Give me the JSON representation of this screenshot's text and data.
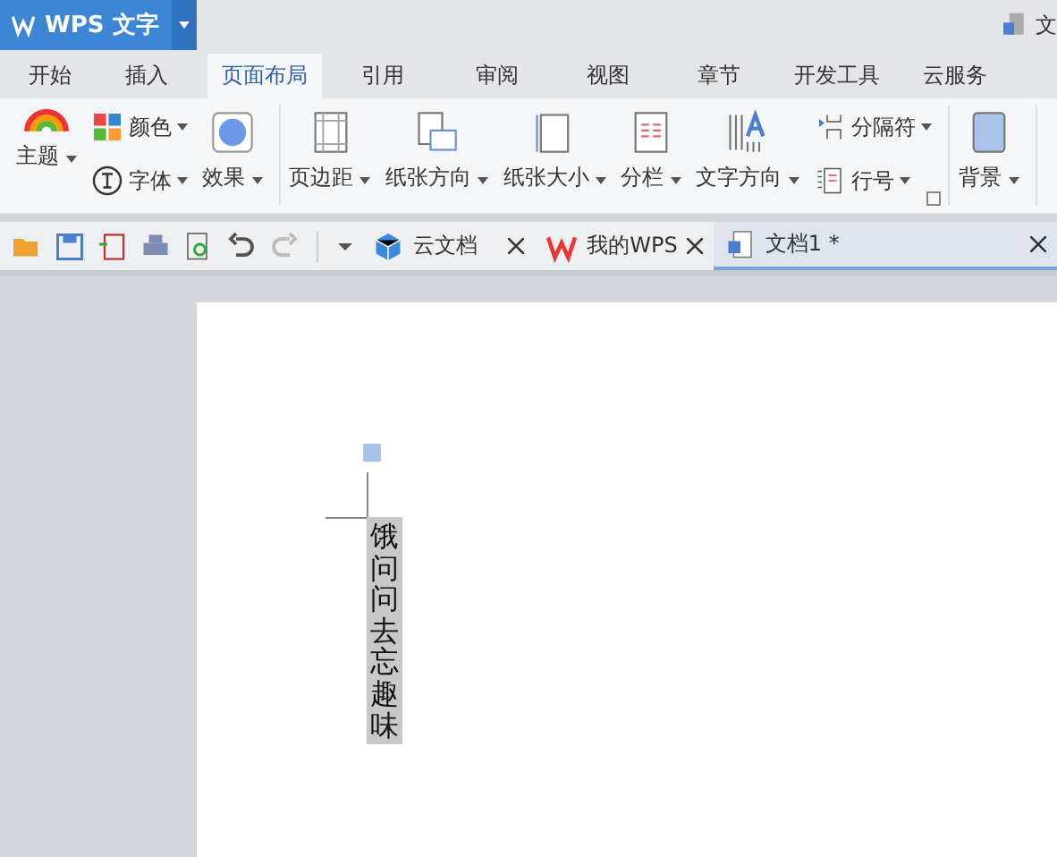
{
  "app_button": {
    "label": "WPS 文字"
  },
  "title_doc": "文",
  "menu_tabs": [
    {
      "label": "开始",
      "selected": false
    },
    {
      "label": "插入",
      "selected": false
    },
    {
      "label": "页面布局",
      "selected": true
    },
    {
      "label": "引用",
      "selected": false
    },
    {
      "label": "审阅",
      "selected": false
    },
    {
      "label": "视图",
      "selected": false
    },
    {
      "label": "章节",
      "selected": false
    },
    {
      "label": "开发工具",
      "selected": false
    },
    {
      "label": "云服务",
      "selected": false
    }
  ],
  "ribbon": {
    "groups": [
      {
        "columns": [
          {
            "kind": "big",
            "label": "主题"
          },
          {
            "kind": "stack",
            "items": [
              {
                "label": "颜色"
              },
              {
                "label": "字体"
              }
            ]
          },
          {
            "kind": "big",
            "label": "效果"
          }
        ]
      },
      {
        "columns": [
          {
            "kind": "big",
            "label": "页边距"
          },
          {
            "kind": "big",
            "label": "纸张方向"
          },
          {
            "kind": "big",
            "label": "纸张大小"
          },
          {
            "kind": "big",
            "label": "分栏"
          },
          {
            "kind": "big",
            "label": "文字方向"
          },
          {
            "kind": "stack",
            "items": [
              {
                "label": "分隔符"
              },
              {
                "label": "行号"
              }
            ]
          }
        ]
      },
      {
        "columns": [
          {
            "kind": "big",
            "label": "背景"
          }
        ]
      }
    ]
  },
  "doc_tabs": [
    {
      "label": "云文档",
      "selected": false
    },
    {
      "label": "我的WPS",
      "selected": false
    },
    {
      "label": "文档1 *",
      "selected": true
    }
  ],
  "document": {
    "vertical_text": "饿问问去忘趣味"
  }
}
